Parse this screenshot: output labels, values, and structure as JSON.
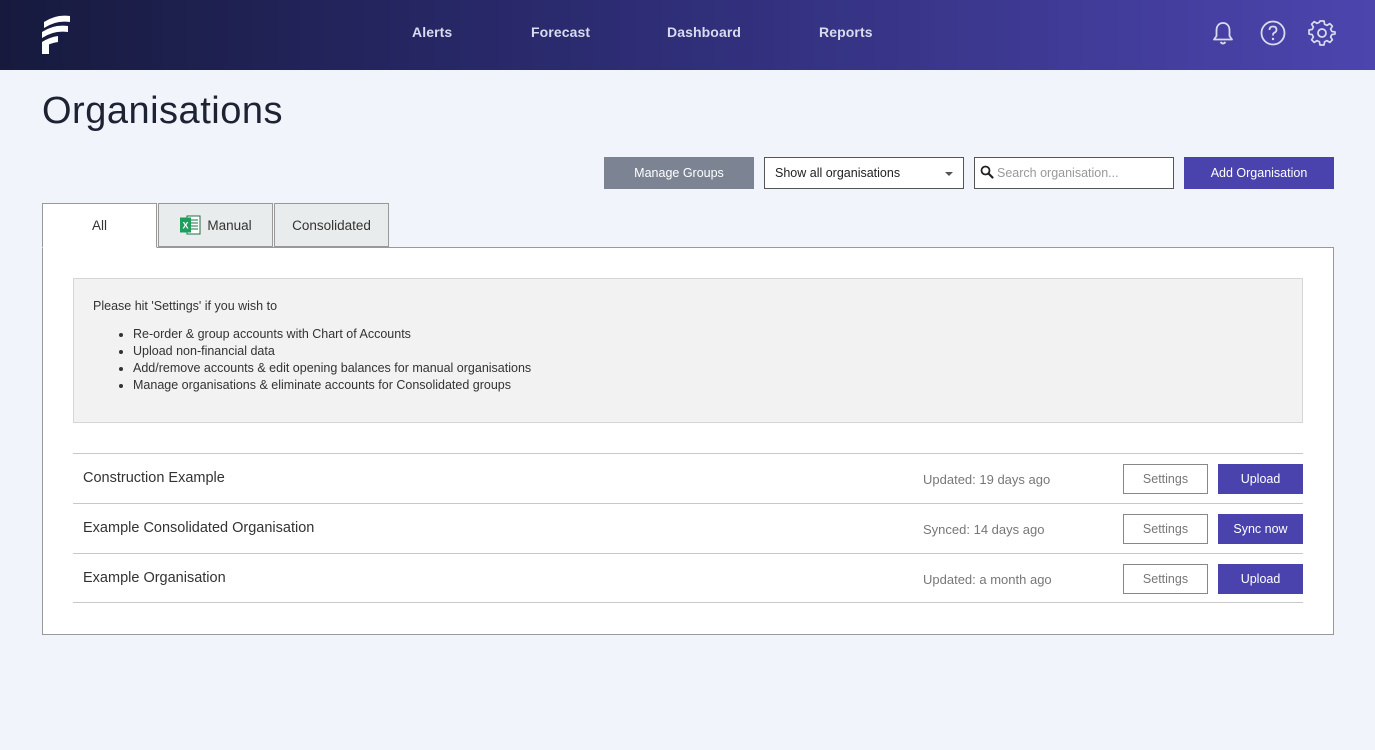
{
  "header": {
    "logo_icon": "fathom-logo-icon",
    "nav": {
      "alerts": "Alerts",
      "forecast": "Forecast",
      "dashboard": "Dashboard",
      "reports": "Reports"
    },
    "icons": [
      "bell-icon",
      "help-icon",
      "gear-icon"
    ],
    "colors": {
      "gradient_start": "#171a3d",
      "gradient_end": "#4c45ae"
    }
  },
  "page": {
    "title": "Organisations"
  },
  "toolbar": {
    "manage_groups_label": "Manage Groups",
    "filter_selected": "Show all organisations",
    "search_placeholder": "Search organisation...",
    "search_value": "",
    "add_label": "Add Organisation"
  },
  "tabs": {
    "all": "All",
    "manual": "Manual",
    "consolidated": "Consolidated",
    "active": "All"
  },
  "info": {
    "intro": "Please hit 'Settings' if you wish to",
    "items": [
      "Re-order & group accounts with Chart of Accounts",
      "Upload non-financial data",
      "Add/remove accounts & edit opening balances for manual organisations",
      "Manage organisations & eliminate accounts for Consolidated groups"
    ]
  },
  "organisations": [
    {
      "name": "Construction Example",
      "status": "Updated: 19 days ago",
      "settings_label": "Settings",
      "action_label": "Upload"
    },
    {
      "name": "Example Consolidated Organisation",
      "status": "Synced: 14 days ago",
      "settings_label": "Settings",
      "action_label": "Sync now"
    },
    {
      "name": "Example Organisation",
      "status": "Updated: a month ago",
      "settings_label": "Settings",
      "action_label": "Upload"
    }
  ],
  "colors": {
    "accent": "#4a43ad",
    "secondary_button": "#7c8494",
    "background": "#f1f4fb"
  }
}
